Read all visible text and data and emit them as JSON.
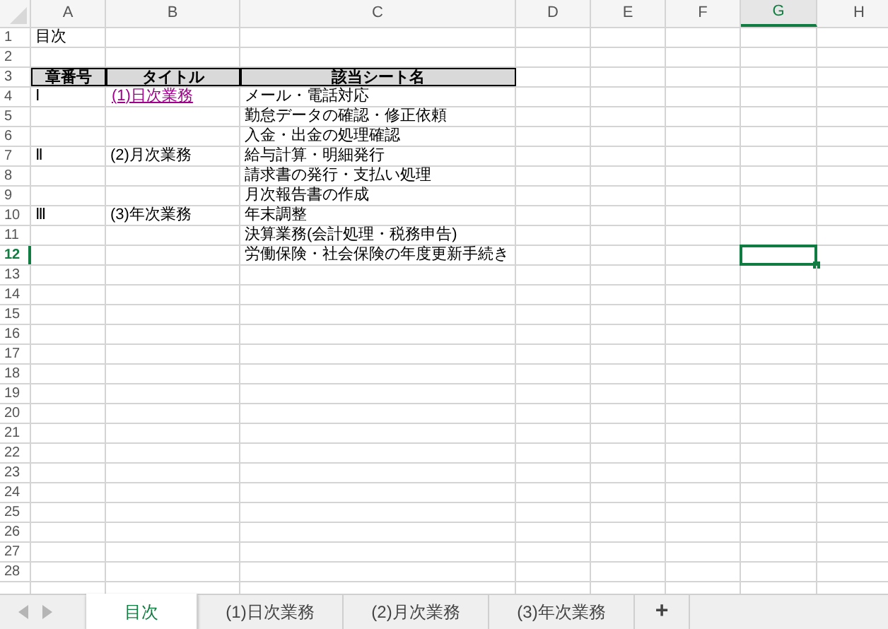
{
  "column_headers": [
    {
      "label": "A",
      "selected": false
    },
    {
      "label": "B",
      "selected": false
    },
    {
      "label": "C",
      "selected": false
    },
    {
      "label": "D",
      "selected": false
    },
    {
      "label": "E",
      "selected": false
    },
    {
      "label": "F",
      "selected": false
    },
    {
      "label": "G",
      "selected": true
    },
    {
      "label": "H",
      "selected": false
    }
  ],
  "rows": [
    {
      "number": "1",
      "selected": false,
      "column_a": "目次"
    },
    {
      "number": "2",
      "selected": false
    },
    {
      "number": "3",
      "selected": false,
      "kind": "table_header",
      "column_a": "章番号",
      "column_b": "タイトル",
      "column_c": "該当シート名"
    },
    {
      "number": "4",
      "selected": false,
      "column_a": "Ⅰ",
      "column_b": "(1)日次業務",
      "column_b_link": true,
      "column_c": "メール・電話対応"
    },
    {
      "number": "5",
      "selected": false,
      "column_c": "勤怠データの確認・修正依頼"
    },
    {
      "number": "6",
      "selected": false,
      "column_c": "入金・出金の処理確認"
    },
    {
      "number": "7",
      "selected": false,
      "column_a": "Ⅱ",
      "column_b": "(2)月次業務",
      "column_b_link": false,
      "column_c": "給与計算・明細発行"
    },
    {
      "number": "8",
      "selected": false,
      "column_c": "請求書の発行・支払い処理"
    },
    {
      "number": "9",
      "selected": false,
      "column_c": "月次報告書の作成"
    },
    {
      "number": "10",
      "selected": false,
      "column_a": "Ⅲ",
      "column_b": "(3)年次業務",
      "column_b_link": false,
      "column_c": "年末調整"
    },
    {
      "number": "11",
      "selected": false,
      "column_c": "決算業務(会計処理・税務申告)"
    },
    {
      "number": "12",
      "selected": true,
      "column_c": "労働保険・社会保険の年度更新手続き"
    },
    {
      "number": "13",
      "selected": false
    },
    {
      "number": "14",
      "selected": false
    },
    {
      "number": "15",
      "selected": false
    },
    {
      "number": "16",
      "selected": false
    },
    {
      "number": "17",
      "selected": false
    },
    {
      "number": "18",
      "selected": false
    },
    {
      "number": "19",
      "selected": false
    },
    {
      "number": "20",
      "selected": false
    },
    {
      "number": "21",
      "selected": false
    },
    {
      "number": "22",
      "selected": false
    },
    {
      "number": "23",
      "selected": false
    },
    {
      "number": "24",
      "selected": false
    },
    {
      "number": "25",
      "selected": false
    },
    {
      "number": "26",
      "selected": false
    },
    {
      "number": "27",
      "selected": false
    },
    {
      "number": "28",
      "selected": false
    }
  ],
  "sheet_tabs": [
    {
      "label": "目次",
      "selected": true
    },
    {
      "label": "(1)日次業務",
      "selected": false
    },
    {
      "label": "(2)月次業務",
      "selected": false
    },
    {
      "label": "(3)年次業務",
      "selected": false
    }
  ],
  "add_sheet": "+"
}
